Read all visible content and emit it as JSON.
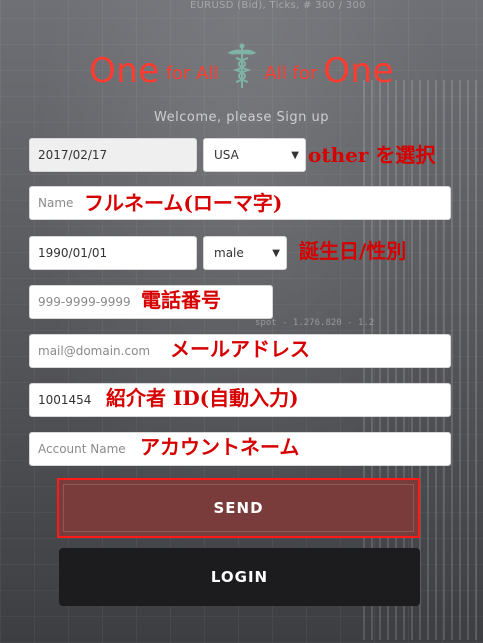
{
  "logo": {
    "part1_big": "One",
    "part1_small": "for All",
    "part2_small": "All for",
    "part2_big": "One",
    "icon": "caduceus-icon",
    "color": "#ff3b2f"
  },
  "background": {
    "ticker_top": "EURUSD (Bid), Ticks, # 300 / 300",
    "ticker_mid": "spot - 1.276.820 - 1.2"
  },
  "subtitle": "Welcome, please Sign up",
  "form": {
    "date_value": "2017/02/17",
    "country_selected": "USA",
    "name_placeholder": "Name",
    "birthdate_value": "1990/01/01",
    "gender_selected": "male",
    "phone_placeholder": "999-9999-9999",
    "email_placeholder": "mail@domain.com",
    "referrer_value": "1001454",
    "account_placeholder": "Account Name"
  },
  "annotations": {
    "country": "other を選択",
    "name": "フルネーム(ローマ字)",
    "birth_gender": "誕生日/性別",
    "phone": "電話番号",
    "email": "メールアドレス",
    "referrer": "紹介者 ID(自動入力)",
    "account": "アカウントネーム",
    "color": "#d60000"
  },
  "buttons": {
    "send": "SEND",
    "login": "LOGIN",
    "send_color": "#7a3b3b",
    "login_color": "#1c1c1f"
  }
}
